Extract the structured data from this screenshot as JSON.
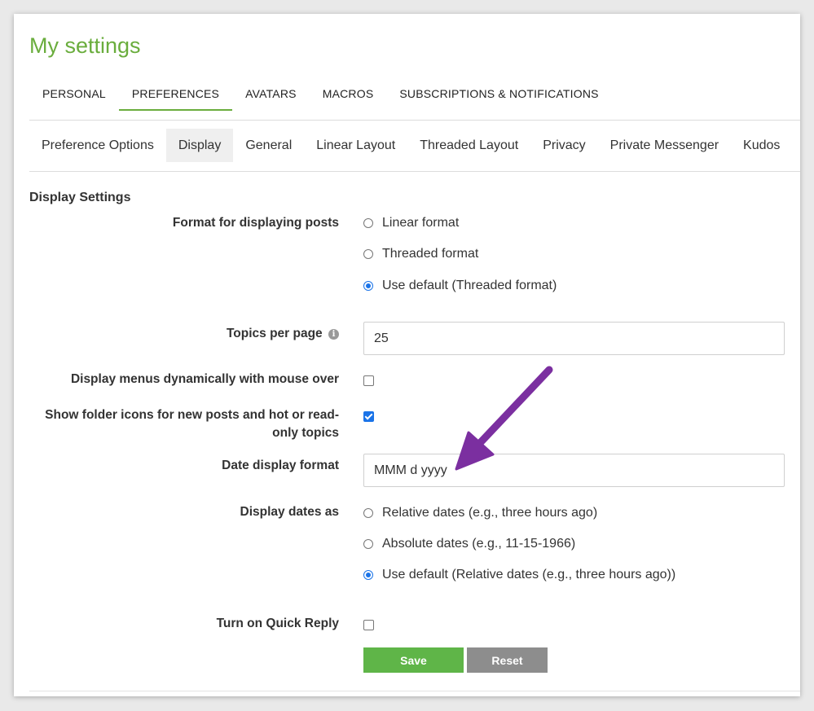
{
  "page_title": "My settings",
  "primary_tabs": [
    {
      "label": "PERSONAL"
    },
    {
      "label": "PREFERENCES"
    },
    {
      "label": "AVATARS"
    },
    {
      "label": "MACROS"
    },
    {
      "label": "SUBSCRIPTIONS & NOTIFICATIONS"
    }
  ],
  "primary_tab_active": "PREFERENCES",
  "sub_tabs": [
    {
      "label": "Preference Options"
    },
    {
      "label": "Display"
    },
    {
      "label": "General"
    },
    {
      "label": "Linear Layout"
    },
    {
      "label": "Threaded Layout"
    },
    {
      "label": "Privacy"
    },
    {
      "label": "Private Messenger"
    },
    {
      "label": "Kudos"
    }
  ],
  "sub_tab_active": "Display",
  "section_title": "Display Settings",
  "format_posts": {
    "label": "Format for displaying posts",
    "options": [
      {
        "label": "Linear format",
        "checked": false
      },
      {
        "label": "Threaded format",
        "checked": false
      },
      {
        "label": "Use default (Threaded format)",
        "checked": true
      }
    ]
  },
  "topics_per_page": {
    "label": "Topics per page",
    "value": "25",
    "icon": "info-icon"
  },
  "display_menus": {
    "label": "Display menus dynamically with mouse over",
    "checked": false
  },
  "folder_icons": {
    "label": "Show folder icons for new posts and hot or read-only topics",
    "checked": true
  },
  "date_format": {
    "label": "Date display format",
    "value": "MMM d yyyy"
  },
  "display_dates": {
    "label": "Display dates as",
    "options": [
      {
        "label": "Relative dates (e.g., three hours ago)",
        "checked": false
      },
      {
        "label": "Absolute dates (e.g., 11-15-1966)",
        "checked": false
      },
      {
        "label": "Use default (Relative dates (e.g., three hours ago))",
        "checked": true
      }
    ]
  },
  "quick_reply": {
    "label": "Turn on Quick Reply",
    "checked": false
  },
  "buttons": {
    "save": "Save",
    "reset": "Reset"
  },
  "colors": {
    "accent_green": "#6aad3d",
    "save_button": "#5fb548",
    "reset_button": "#8d8d8d",
    "control_blue": "#1a73e8",
    "annotation_arrow": "#7b2fa0"
  }
}
